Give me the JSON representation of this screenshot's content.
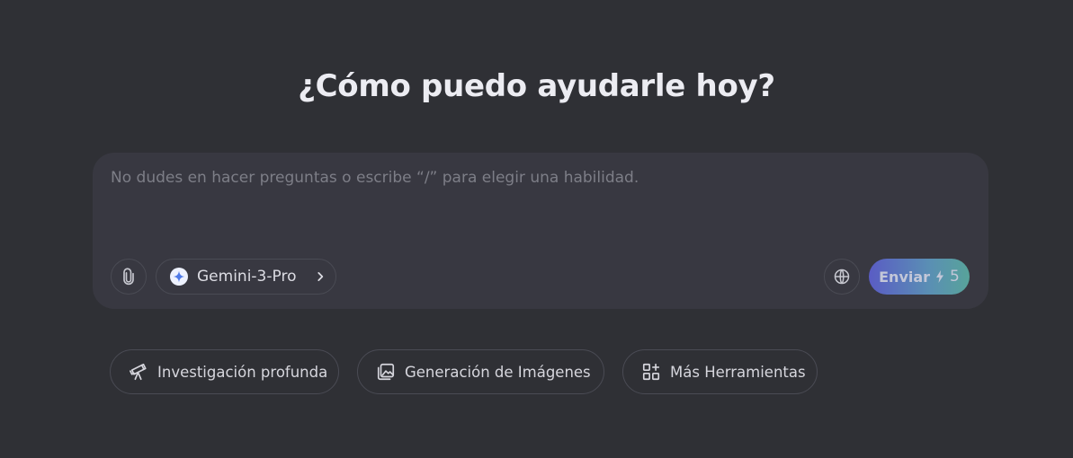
{
  "heading": "¿Cómo puedo ayudarle hoy?",
  "composer": {
    "placeholder": "No dudes en hacer preguntas o escribe “/” para elegir una habilidad.",
    "value": "",
    "attach_icon": "paperclip-icon",
    "model": {
      "label": "Gemini-3-Pro",
      "icon": "gemini-sparkle-icon",
      "chevron": "chevron-right-icon"
    },
    "web_icon": "globe-icon",
    "send": {
      "label": "Enviar",
      "credit_icon": "lightning-icon",
      "credits": "5"
    }
  },
  "tools": [
    {
      "label": "Investigación profunda",
      "icon": "telescope-icon"
    },
    {
      "label": "Generación de Imágenes",
      "icon": "image-gallery-icon"
    },
    {
      "label": "Más Herramientas",
      "icon": "apps-grid-icon"
    }
  ],
  "colors": {
    "background": "#2f3035",
    "composer": "#383841",
    "send_gradient_start": "#5a5cc4",
    "send_gradient_end": "#58a39a"
  }
}
